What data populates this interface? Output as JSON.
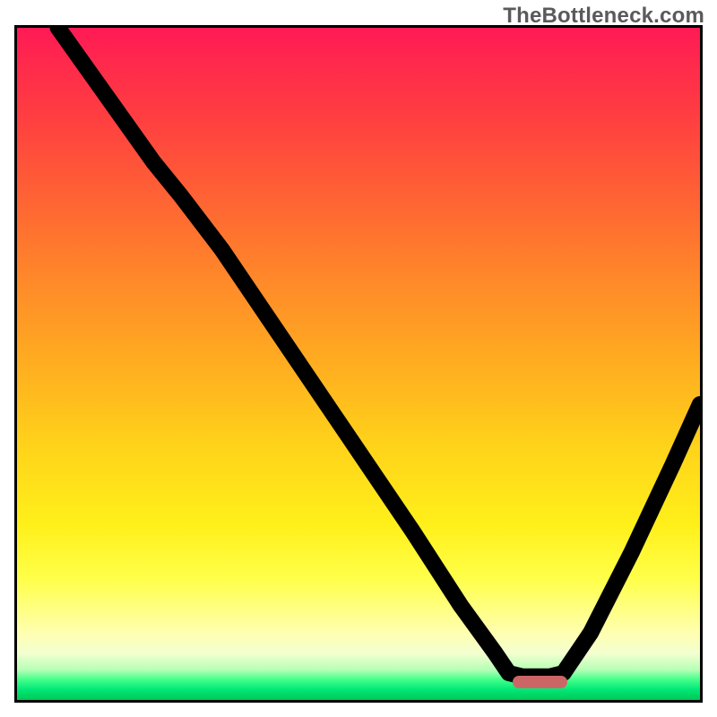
{
  "watermark": "TheBottleneck.com",
  "colors": {
    "gradient_top": "#ff1a55",
    "gradient_mid": "#ffd21a",
    "gradient_bottom": "#00c853",
    "curve": "#000000",
    "marker": "#cc6666",
    "frame": "#000000"
  },
  "chart_data": {
    "type": "line",
    "title": "",
    "xlabel": "",
    "ylabel": "",
    "xlim": [
      0,
      100
    ],
    "ylim": [
      0,
      100
    ],
    "grid": false,
    "legend": false,
    "background": "red-yellow-green vertical gradient",
    "series": [
      {
        "name": "bottleneck-curve",
        "comment": "y is percent from top (0=top, 100=bottom). Starts top-left, dips to a flat minimum near x≈72-80, rises toward right edge.",
        "points": [
          {
            "x": 6,
            "y": 0
          },
          {
            "x": 13,
            "y": 10
          },
          {
            "x": 20,
            "y": 20
          },
          {
            "x": 24,
            "y": 25
          },
          {
            "x": 30,
            "y": 33
          },
          {
            "x": 40,
            "y": 48
          },
          {
            "x": 50,
            "y": 63
          },
          {
            "x": 58,
            "y": 75
          },
          {
            "x": 65,
            "y": 86
          },
          {
            "x": 70,
            "y": 93
          },
          {
            "x": 72,
            "y": 96
          },
          {
            "x": 74,
            "y": 96.5
          },
          {
            "x": 78,
            "y": 96.5
          },
          {
            "x": 80,
            "y": 96
          },
          {
            "x": 84,
            "y": 90
          },
          {
            "x": 90,
            "y": 78
          },
          {
            "x": 96,
            "y": 65
          },
          {
            "x": 100,
            "y": 56
          }
        ]
      }
    ],
    "marker": {
      "comment": "rounded red bar sitting on the flat trough of the curve",
      "x_start": 72,
      "x_end": 80,
      "y": 96.5
    }
  }
}
